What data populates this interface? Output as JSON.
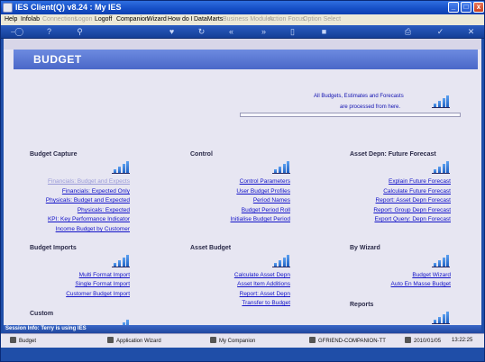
{
  "window": {
    "title": "IES Client(Q) v8.24 : My IES",
    "controls": [
      "_",
      "□",
      "x"
    ]
  },
  "menu": [
    {
      "label": "Help",
      "enabled": true
    },
    {
      "label": "Infolab",
      "enabled": true
    },
    {
      "label": "Connections",
      "enabled": false
    },
    {
      "label": "Logon",
      "enabled": false
    },
    {
      "label": "Logoff",
      "enabled": true
    },
    {
      "label": "Companion",
      "enabled": true
    },
    {
      "label": "Wizard",
      "enabled": true
    },
    {
      "label": "How do I",
      "enabled": true
    },
    {
      "label": "DataMarts",
      "enabled": true
    },
    {
      "label": "Business Modules",
      "enabled": false
    },
    {
      "label": "Action Focus",
      "enabled": false
    },
    {
      "label": "Option Select",
      "enabled": false
    }
  ],
  "toolbar": [
    "key-icon",
    "help-icon",
    "search-icon",
    "heart-icon",
    "refresh-icon",
    "back-icon",
    "forward-icon",
    "document-icon",
    "stop-icon",
    "print-icon",
    "ok-icon",
    "close-icon"
  ],
  "page": {
    "title": "BUDGET",
    "info_line1": "All Budgets, Estimates and Forecasts",
    "info_line2": "are processed from here."
  },
  "sections": {
    "budget_capture": {
      "heading": "Budget Capture",
      "links": [
        "Financials: Budget and Expects",
        "Financials: Expected Only",
        "Physicals: Budget and Expected",
        "Physicals: Expected",
        "KPI: Key Performance Indicator",
        "Income Budget by Customer"
      ]
    },
    "control": {
      "heading": "Control",
      "links": [
        "Control Parameters",
        "User Budget Profiles",
        "Period Names",
        "Budget Period Roll",
        "Initialise Budget Period"
      ]
    },
    "asset_depn": {
      "heading": "Asset Depn: Future Forecast",
      "links": [
        "Explain Future Forecast",
        "Calculate Future Forecast",
        "Report: Asset Depn Forecast",
        "Report: Group Depn Forecast",
        "Export Query: Depn Forecast"
      ]
    },
    "budget_imports": {
      "heading": "Budget Imports",
      "links": [
        "Multi Format Import",
        "Single Format Import",
        "Customer Budget Import"
      ]
    },
    "asset_budget": {
      "heading": "Asset Budget",
      "links": [
        "Calculate Asset Depn",
        "Asset Item Additions",
        "Report: Asset Depn",
        "Transfer to Budget"
      ]
    },
    "by_wizard": {
      "heading": "By Wizard",
      "links": [
        "Budget Wizard",
        "Auto En Masse Budget"
      ]
    },
    "custom": {
      "heading": "Custom"
    },
    "reports": {
      "heading": "Reports"
    }
  },
  "status": {
    "session_info": "Session Info: Terry is using IES"
  },
  "taskbar": {
    "module": "Budget",
    "wizard": "Application Wizard",
    "companion": "My Companion",
    "server": "GFRIEND-COMPANION-TT",
    "date": "2010/01/05",
    "time": "13:22:25"
  },
  "colors": {
    "link": "#1212c8",
    "banner": "#5a78d4",
    "frame": "#1f4ea8"
  }
}
